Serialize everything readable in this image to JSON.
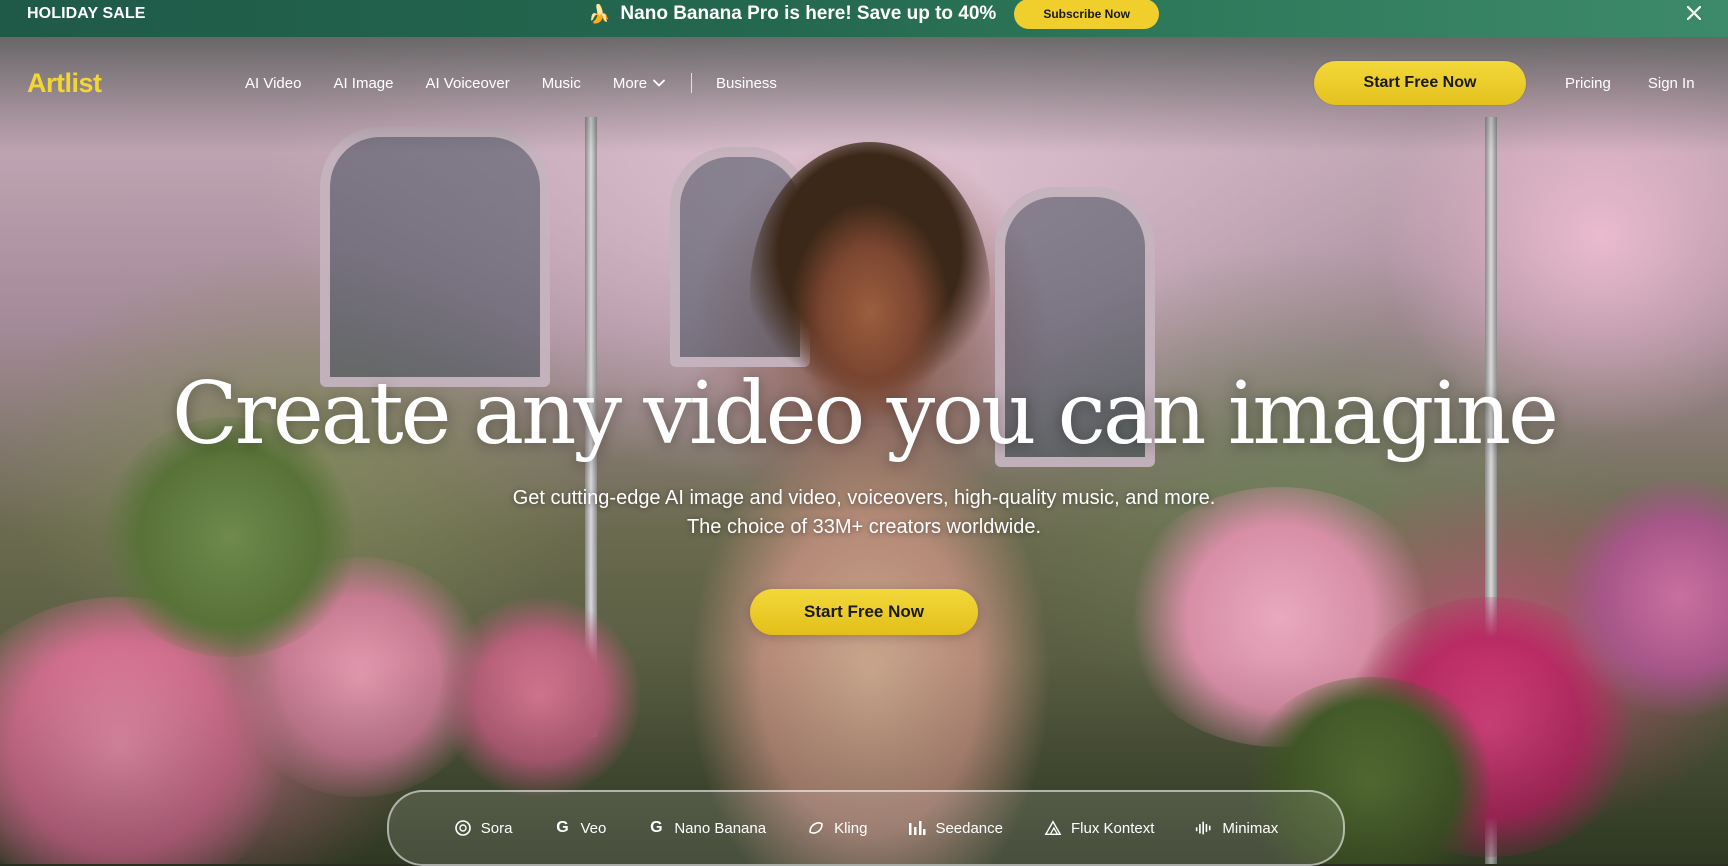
{
  "promo": {
    "left_label": "HOLIDAY SALE",
    "icon": "banana-icon",
    "message": "Nano Banana Pro is here! Save up to 40%",
    "subscribe_label": "Subscribe Now",
    "close_icon": "close-icon"
  },
  "nav": {
    "logo": "Artlist",
    "links": [
      "AI Video",
      "AI Image",
      "AI Voiceover",
      "Music"
    ],
    "more_label": "More",
    "business_label": "Business",
    "cta_label": "Start Free Now",
    "pricing_label": "Pricing",
    "signin_label": "Sign In"
  },
  "hero": {
    "title": "Create any video you can imagine",
    "subtitle_line1": "Get cutting-edge AI image and video, voiceovers, high-quality music, and more.",
    "subtitle_line2": "The choice of 33M+ creators worldwide.",
    "cta_label": "Start Free Now"
  },
  "models": {
    "items": [
      {
        "label": "Sora",
        "icon": "sora-icon"
      },
      {
        "label": "Veo",
        "icon": "google-icon"
      },
      {
        "label": "Nano Banana",
        "icon": "google-icon"
      },
      {
        "label": "Kling",
        "icon": "kling-icon"
      },
      {
        "label": "Seedance",
        "icon": "seedance-icon"
      },
      {
        "label": "Flux Kontext",
        "icon": "flux-icon"
      },
      {
        "label": "Minimax",
        "icon": "minimax-icon"
      }
    ]
  },
  "colors": {
    "accent_yellow": "#f0cf2c",
    "banner_green": "#24684f",
    "logo_yellow": "#f2d631"
  }
}
